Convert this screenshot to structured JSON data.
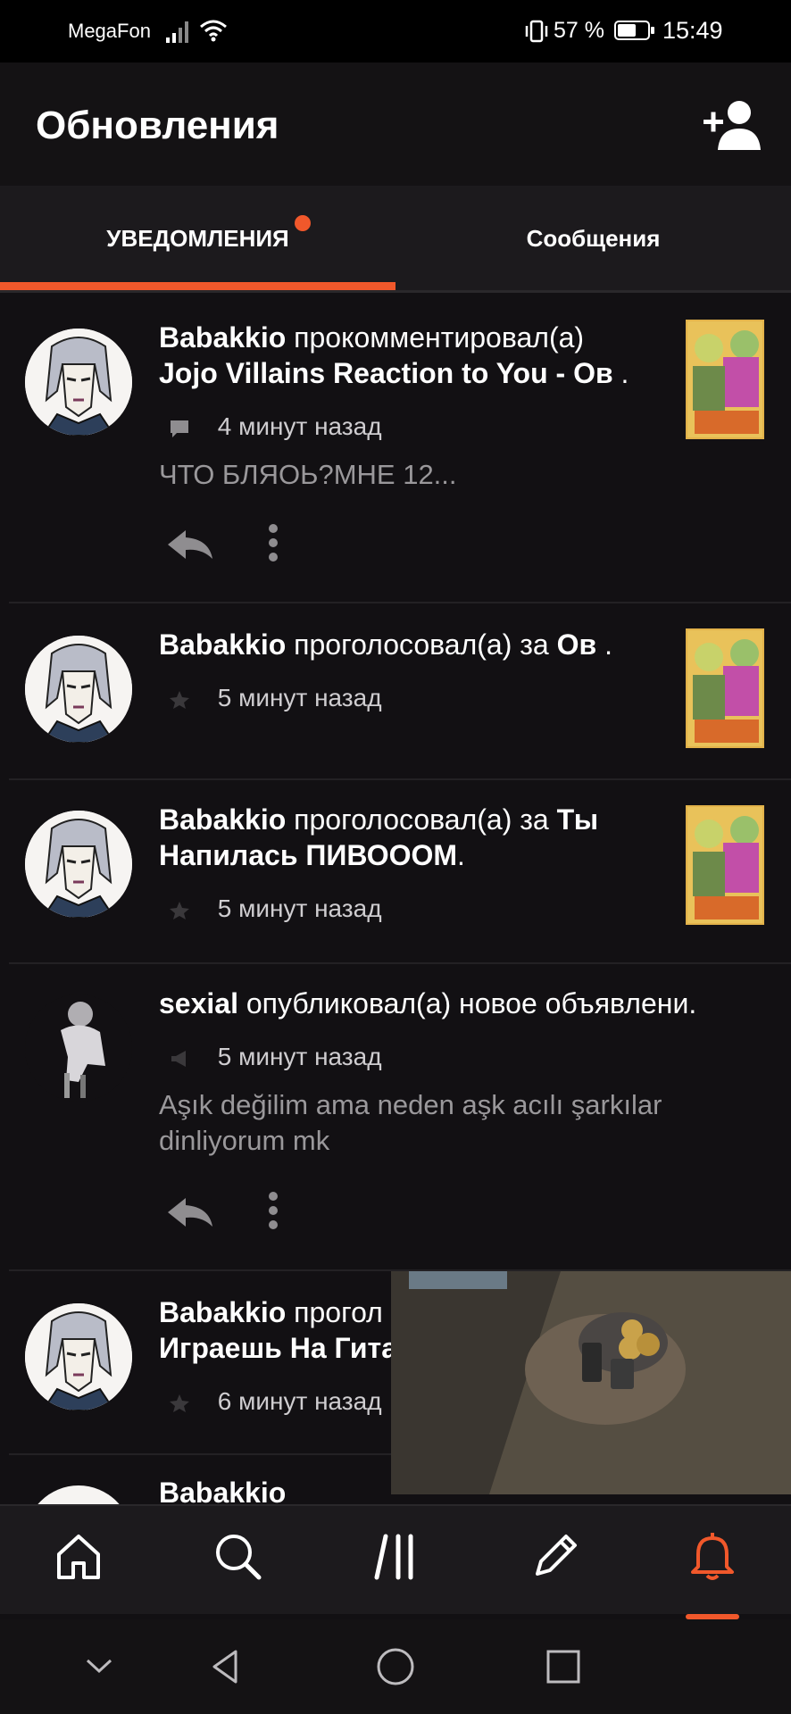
{
  "status_bar": {
    "carrier": "MegaFon",
    "battery_percent": "57 %",
    "time": "15:49"
  },
  "header": {
    "title": "Обновления",
    "add_user_icon": "add-user-icon"
  },
  "tabs": [
    {
      "label": "УВЕДОМЛЕНИЯ",
      "active": true,
      "has_badge": true
    },
    {
      "label": "Сообщения",
      "active": false
    }
  ],
  "notifications": [
    {
      "user": "Babakkio",
      "action": "прокомментировал(а)",
      "target": "Jojo Villains Reaction to You - Ов",
      "target_suffix": ".",
      "meta_icon": "comment-icon",
      "time": "4 минут назад",
      "snippet": "ЧТО БЛЯОЬ?МНЕ 12..."
    },
    {
      "user": "Babakkio",
      "action": "проголосовал(а) за",
      "target": "Ов",
      "target_suffix": ".",
      "meta_icon": "star-icon",
      "time": "5 минут назад"
    },
    {
      "user": "Babakkio",
      "action": "проголосовал(а) за",
      "target": "Ты Напилась ПИВОООМ",
      "target_suffix": ".",
      "meta_icon": "star-icon",
      "time": "5 минут назад"
    },
    {
      "user": "sexial",
      "action": "опубликовал(а) новое объявлени.",
      "meta_icon": "megaphone-icon",
      "time": "5 минут назад",
      "snippet": "Aşık değilim ama neden aşk acılı şarkılar dinliyorum mk"
    },
    {
      "user": "Babakkio",
      "action": "прогол",
      "target": "Играешь На Гита",
      "meta_icon": "star-icon",
      "time": "6 минут назад"
    },
    {
      "user": "Babakkio"
    }
  ],
  "bottom_nav": [
    "home-icon",
    "search-icon",
    "library-icon",
    "write-icon",
    "bell-icon"
  ],
  "colors": {
    "accent": "#f1582b",
    "background": "#121013",
    "tab_bar": "#1c1a1d"
  }
}
